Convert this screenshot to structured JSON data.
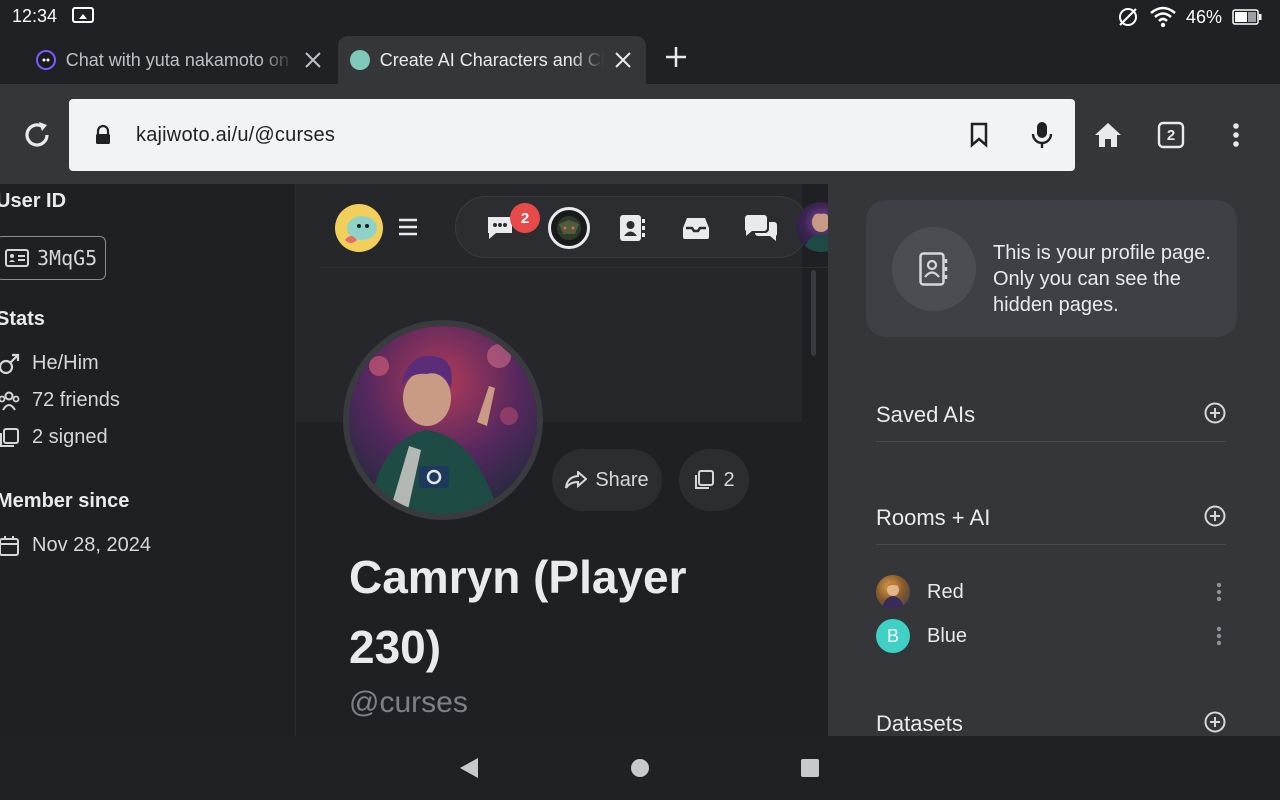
{
  "status": {
    "time": "12:34",
    "battery": "46%"
  },
  "tabs": [
    {
      "title": "Chat with yuta nakamoto on Kajiwoto",
      "active": false
    },
    {
      "title": "Create AI Characters and Chat",
      "active": true
    }
  ],
  "toolbar": {
    "url": "kajiwoto.ai/u/@curses",
    "tab_count": "2"
  },
  "left": {
    "user_id_heading": "User ID",
    "user_id": "3MqG5",
    "stats_heading": "Stats",
    "pronouns": "He/Him",
    "friends": "72 friends",
    "signed": "2 signed",
    "member_heading": "Member since",
    "member_date": "Nov 28, 2024"
  },
  "nav": {
    "message_badge": "2"
  },
  "profile": {
    "share_label": "Share",
    "signed_count": "2",
    "name": "Camryn (Player 230)",
    "handle": "@curses"
  },
  "right": {
    "info_text": "This is your profile page. Only you can see the hidden pages.",
    "saved_ais": "Saved AIs",
    "rooms": "Rooms + AI",
    "room_items": [
      {
        "name": "Red",
        "avatar_letter": ""
      },
      {
        "name": "Blue",
        "avatar_letter": "B"
      }
    ],
    "datasets": "Datasets"
  },
  "colors": {
    "badge": "#e84a4a",
    "blue_avatar": "#3fd1c6"
  }
}
